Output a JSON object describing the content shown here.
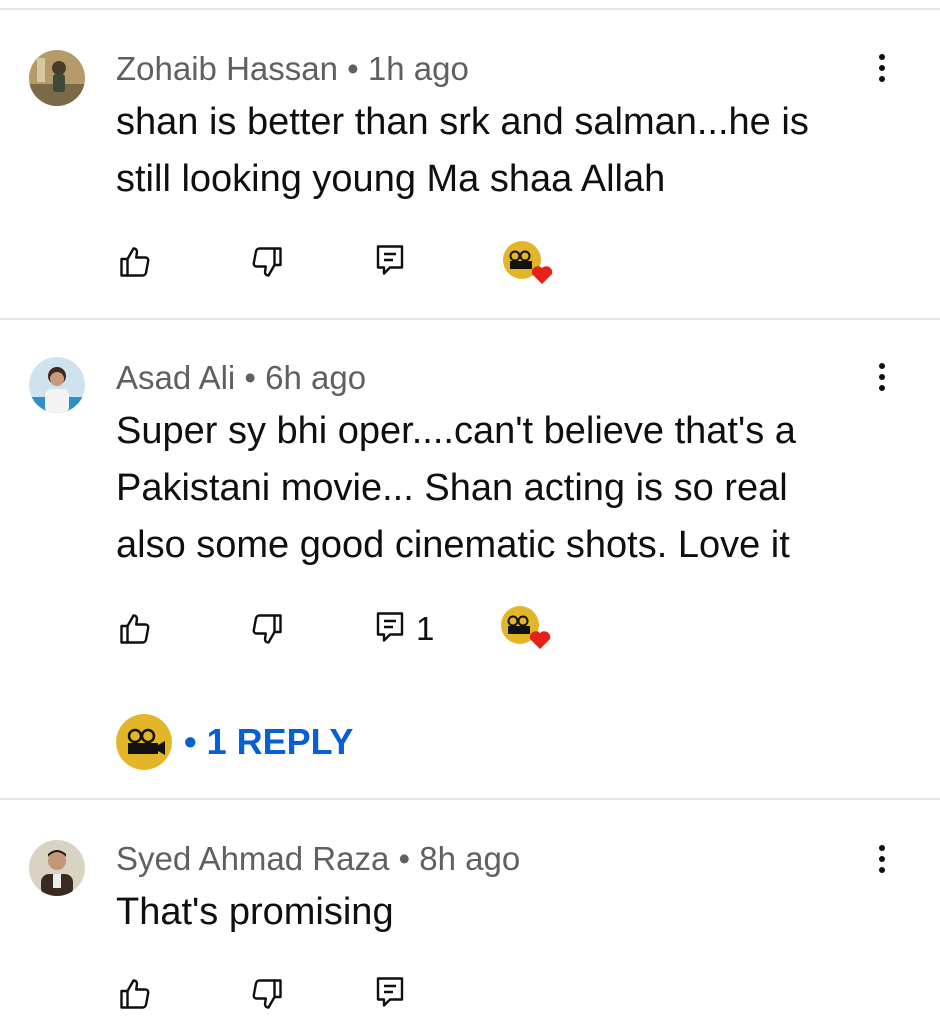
{
  "comments": [
    {
      "author": "Zohaib Hassan",
      "time": "1h ago",
      "text_lines": [
        "shan is better than srk and salman...he is",
        "still looking young Ma shaa Allah"
      ],
      "reply_count": "",
      "hearted": true
    },
    {
      "author": "Asad Ali",
      "time": "6h ago",
      "text_lines": [
        "Super sy bhi oper....can't believe that's a",
        "Pakistani movie... Shan acting is so real",
        "also some good cinematic shots. Love it"
      ],
      "reply_count": "1",
      "hearted": true,
      "replies_link": "• 1 REPLY"
    },
    {
      "author": "Syed Ahmad Raza",
      "time": "8h ago",
      "text_lines": [
        "That's promising"
      ],
      "reply_count": "",
      "hearted": false
    }
  ],
  "separator": " • ",
  "icons": {
    "like": "thumb-up-icon",
    "dislike": "thumb-down-icon",
    "reply": "comment-reply-icon",
    "more": "more-vertical-icon",
    "heart": "creator-heart-icon"
  },
  "colors": {
    "link": "#065fd4",
    "heart": "#e62117",
    "meta": "#606060"
  }
}
